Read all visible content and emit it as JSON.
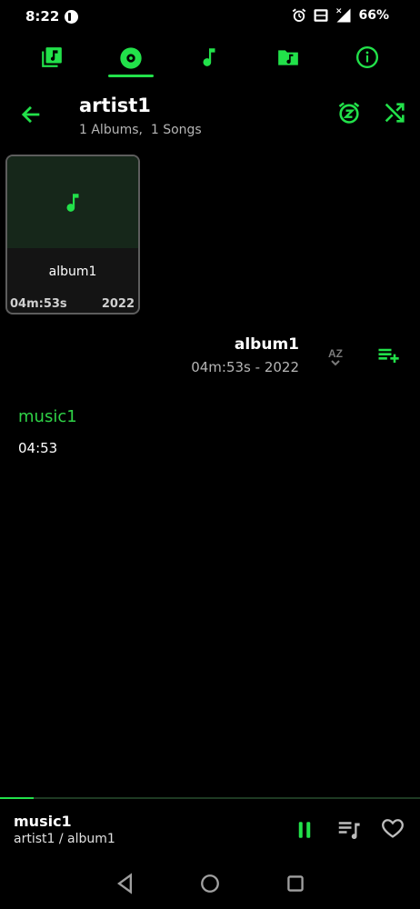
{
  "status": {
    "time": "8:22",
    "battery": "66%"
  },
  "tabs": [
    {
      "icon": "library-icon",
      "active": false
    },
    {
      "icon": "album-disc-icon",
      "active": true
    },
    {
      "icon": "music-note-icon",
      "active": false
    },
    {
      "icon": "music-folder-icon",
      "active": false
    },
    {
      "icon": "info-icon",
      "active": false
    }
  ],
  "header": {
    "title": "artist1",
    "subtitle": "1 Albums,  1 Songs"
  },
  "album_card": {
    "name": "album1",
    "duration": "04m:53s",
    "year": "2022"
  },
  "album_section": {
    "title": "album1",
    "subtitle": "04m:53s - 2022",
    "sort_label": "AZ"
  },
  "songs": [
    {
      "title": "music1",
      "duration": "04:53"
    }
  ],
  "mini_player": {
    "title": "music1",
    "subtitle": "artist1 / album1",
    "progress": 0.08
  },
  "colors": {
    "accent": "#22e14a",
    "background": "#000000",
    "text_secondary": "#b5b5b5"
  }
}
